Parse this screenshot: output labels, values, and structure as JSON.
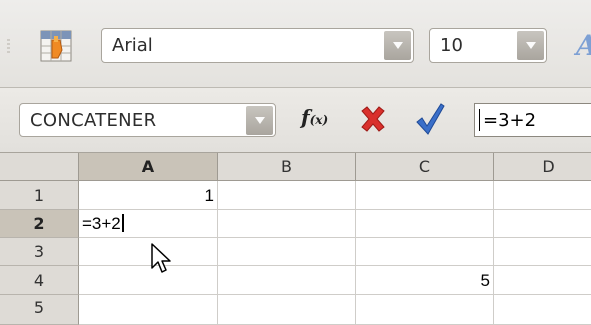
{
  "toolbar": {
    "font_name": "Arial",
    "font_size": "10"
  },
  "formula_bar": {
    "name_box": "CONCATENER",
    "function_wizard_label": "f(x)",
    "input_line": "=3+2"
  },
  "grid": {
    "columns": [
      "A",
      "B",
      "C",
      "D"
    ],
    "active_column": "A",
    "rows": [
      "1",
      "2",
      "3",
      "4",
      "5"
    ],
    "active_row": "2",
    "cells": {
      "A1": "1",
      "A2": "=3+2",
      "C4": "5"
    }
  },
  "colors": {
    "header_bg": "#dedbd6",
    "active_header_bg": "#c9c3b8",
    "cancel_red": "#d9302c",
    "accept_blue": "#3a6fc9"
  }
}
